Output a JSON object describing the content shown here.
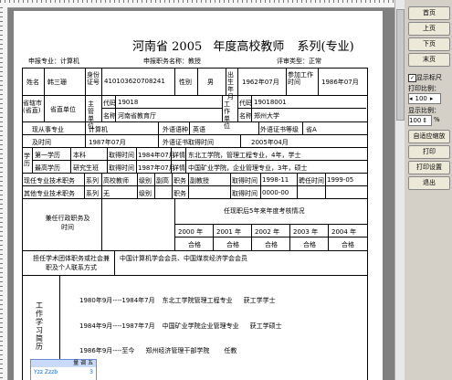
{
  "form": {
    "title_province": "河南省",
    "title_year": "2005",
    "title_rest": "年度高校教师",
    "title_series": "系列(专业)",
    "declare_major_label": "申报专业：",
    "declare_major_value": "计算机",
    "declare_title_label": "申报职务名称：",
    "declare_title_value": "教授",
    "review_type_label": "评审类型：",
    "review_type_value": "正常",
    "name_label": "姓名",
    "name_value": "韩三珊",
    "id_label": "身份证号",
    "id_value": "410103620708241",
    "sex_label": "性别",
    "sex_value": "男",
    "birth_label": "出生年月",
    "birth_value": "1962年07月",
    "work_start_label": "参加工作时间",
    "work_start_value": "1986年07月",
    "city_label": "省辖市(省直)",
    "city_value": "省直单位",
    "dept_label": "主管单位",
    "code_label": "代码",
    "dept_code": "19018",
    "dept_name_label": "名称",
    "dept_name": "河南省教育厅",
    "unit_label": "工作单位",
    "unit_code": "19018001",
    "unit_name": "郑州大学",
    "current_major_label": "现从事专业",
    "current_major_value": "计算机",
    "fl_cert_label": "外语语种",
    "fl_cert_value": "英语",
    "fl_grade_label": "外语证书等级",
    "fl_grade_value": "省A",
    "since_label": "及时间",
    "since_value": "1987年07月",
    "fl_time_label": "外语证书取得时间",
    "fl_time_value": "2005年04月",
    "edu_label": "学历",
    "first_edu_label": "第一学历",
    "first_edu_value": "本科",
    "first_edu_time_label": "取得时间",
    "first_edu_time": "1984年07月",
    "first_detail_label": "详情",
    "first_detail": "东北工学院，管理工程专业，4年，学士",
    "high_edu_label": "最高学历",
    "high_edu_value": "研究生班",
    "high_edu_time_label": "取得时间",
    "high_edu_time": "1987年07月",
    "high_detail_label": "详情",
    "high_detail": "中国矿业学院，企业管理专业，3年，硕士",
    "tech_title_label": "现任专业技术职务",
    "series_label": "系列",
    "series_value": "高校教师",
    "level_label": "级别",
    "level_value": "副高",
    "post_label": "职务",
    "post_value": "副教授",
    "get_time_label": "取得时间",
    "get_time_value": "1998-11",
    "hire_time_label": "聘任时间",
    "hire_time_value": "1999-05",
    "other_title_label": "其他专业技术职务",
    "other_series_label": "系列",
    "other_series_value": "无",
    "other_level_label": "级别",
    "other_post_label": "职务",
    "other_get_label": "取得时间",
    "other_get_value": "0000-00",
    "admin_label": "兼任行政职务及时间",
    "assess_label": "任现职后5年来年度考核情况",
    "assess_years": [
      "2000",
      "2001",
      "2002",
      "2003",
      "2004"
    ],
    "year_suffix": "年",
    "assess_results": [
      "合格",
      "合格",
      "合格",
      "合格",
      "合格"
    ],
    "society_label": "担任学术团体职务或社会兼职及个人联系方式",
    "society_value": "中国计算机学会会员、中国煤炭经济学会会员",
    "history_label": "工作学习简历",
    "history": [
      {
        "period": "1980年9月----1984年7月",
        "place": "东北工学院管理工程专业",
        "role": "获工学学士"
      },
      {
        "period": "1984年9月----1987年7月",
        "place": "中国矿业学院企业管理专业",
        "role": "获工学硕士"
      },
      {
        "period": "1986年9月----至今",
        "place": "郑州经济管理干部学院",
        "role": "任教"
      }
    ]
  },
  "panel": {
    "first_page": "首页",
    "prev_page": "上页",
    "next_page": "下页",
    "last_page": "末页",
    "show_ruler": "显示标尺",
    "print_scale": "打印比例：",
    "print_scale_value": "100",
    "display_scale": "显示比例：",
    "display_scale_value": "100",
    "percent": "%",
    "auto_fit": "自适应缩放",
    "print": "打印",
    "print_setup": "打印设置",
    "exit": "退出"
  },
  "mini_window": {
    "title": "量 调 五",
    "code": "Yzz Zzzb",
    "num": "3"
  }
}
